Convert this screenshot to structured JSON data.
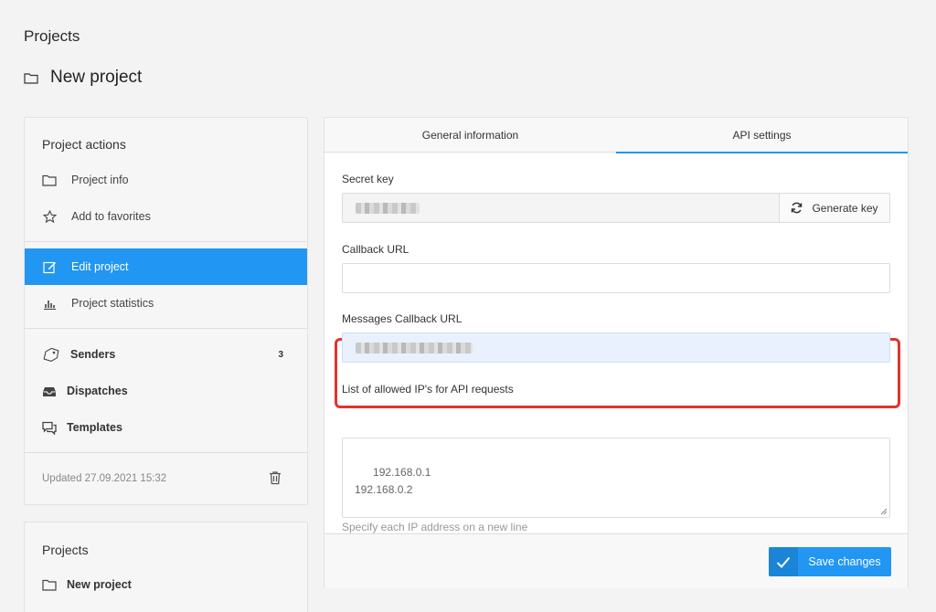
{
  "breadcrumb": "Projects",
  "page_title": "New project",
  "sidebar": {
    "heading": "Project actions",
    "items": [
      {
        "label": "Project info",
        "icon": "folder-icon"
      },
      {
        "label": "Add to favorites",
        "icon": "star-icon"
      },
      {
        "label": "Edit project",
        "icon": "edit-icon",
        "active": true
      },
      {
        "label": "Project statistics",
        "icon": "bar-chart-icon"
      },
      {
        "label": "Senders",
        "icon": "tag-icon",
        "badge": "3"
      },
      {
        "label": "Dispatches",
        "icon": "inbox-icon"
      },
      {
        "label": "Templates",
        "icon": "chat-icon"
      }
    ],
    "updated": "Updated 27.09.2021 15:32"
  },
  "projects_card": {
    "heading": "Projects",
    "items": [
      {
        "label": "New project",
        "icon": "folder-icon"
      }
    ]
  },
  "tabs": [
    {
      "label": "General information",
      "active": false
    },
    {
      "label": "API settings",
      "active": true
    }
  ],
  "form": {
    "secret_key_label": "Secret key",
    "generate_key_label": "Generate key",
    "callback_url_label": "Callback URL",
    "callback_url_value": "",
    "messages_callback_label": "Messages Callback URL",
    "allowed_ips_label": "List of allowed IP's for API requests",
    "allowed_ips_placeholder": "192.168.0.1\n192.168.0.2",
    "allowed_ips_hint": "Specify each IP address on a new line"
  },
  "footer": {
    "save_label": "Save changes"
  },
  "colors": {
    "accent": "#2196f3",
    "highlight": "#e0342c"
  }
}
